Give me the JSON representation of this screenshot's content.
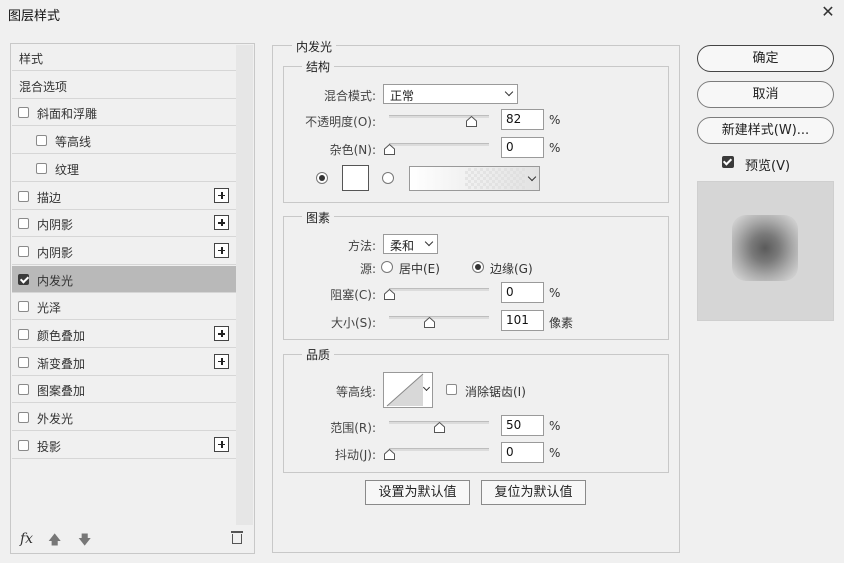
{
  "window": {
    "title": "图层样式"
  },
  "left_list": {
    "items": [
      {
        "label": "样式",
        "checkbox": false,
        "checked": false,
        "plus": false,
        "selected": false
      },
      {
        "label": "混合选项",
        "checkbox": false,
        "checked": false,
        "plus": false,
        "selected": false
      },
      {
        "label": "斜面和浮雕",
        "checkbox": true,
        "checked": false,
        "plus": false,
        "selected": false
      },
      {
        "label": "等高线",
        "checkbox": true,
        "checked": false,
        "plus": false,
        "selected": false
      },
      {
        "label": "纹理",
        "checkbox": true,
        "checked": false,
        "plus": false,
        "selected": false
      },
      {
        "label": "描边",
        "checkbox": true,
        "checked": false,
        "plus": true,
        "selected": false
      },
      {
        "label": "内阴影",
        "checkbox": true,
        "checked": false,
        "plus": true,
        "selected": false
      },
      {
        "label": "内阴影",
        "checkbox": true,
        "checked": false,
        "plus": true,
        "selected": false
      },
      {
        "label": "内发光",
        "checkbox": true,
        "checked": true,
        "plus": false,
        "selected": true
      },
      {
        "label": "光泽",
        "checkbox": true,
        "checked": false,
        "plus": false,
        "selected": false
      },
      {
        "label": "颜色叠加",
        "checkbox": true,
        "checked": false,
        "plus": true,
        "selected": false
      },
      {
        "label": "渐变叠加",
        "checkbox": true,
        "checked": false,
        "plus": true,
        "selected": false
      },
      {
        "label": "图案叠加",
        "checkbox": true,
        "checked": false,
        "plus": false,
        "selected": false
      },
      {
        "label": "外发光",
        "checkbox": true,
        "checked": false,
        "plus": false,
        "selected": false
      },
      {
        "label": "投影",
        "checkbox": true,
        "checked": false,
        "plus": true,
        "selected": false
      }
    ],
    "footer": {
      "fx": "fx"
    }
  },
  "inner_glow": {
    "section_title": "内发光",
    "structure": {
      "title": "结构",
      "blend_mode_label": "混合模式:",
      "blend_mode_value": "正常",
      "opacity_label": "不透明度(O):",
      "opacity_value": "82",
      "opacity_unit": "%",
      "opacity_level": 0.82,
      "noise_label": "杂色(N):",
      "noise_value": "0",
      "noise_unit": "%",
      "noise_level": 0.0,
      "glow_color": "#ffffff"
    },
    "elements": {
      "title": "图素",
      "method_label": "方法:",
      "method_value": "柔和",
      "source_label": "源:",
      "source_center": "居中(E)",
      "source_edge": "边缘(G)",
      "choke_label": "阻塞(C):",
      "choke_value": "0",
      "choke_unit": "%",
      "choke_level": 0.0,
      "size_label": "大小(S):",
      "size_value": "101",
      "size_unit": "像素",
      "size_level": 0.4
    },
    "quality": {
      "title": "品质",
      "contour_label": "等高线:",
      "antialias_label": "消除锯齿(I)",
      "range_label": "范围(R):",
      "range_value": "50",
      "range_unit": "%",
      "range_level": 0.5,
      "jitter_label": "抖动(J):",
      "jitter_value": "0",
      "jitter_unit": "%",
      "jitter_level": 0.0
    },
    "buttons": {
      "make_default": "设置为默认值",
      "reset_default": "复位为默认值"
    }
  },
  "right": {
    "ok": "确定",
    "cancel": "取消",
    "new_style": "新建样式(W)...",
    "preview_label": "预览(V)",
    "preview_checked": true
  }
}
